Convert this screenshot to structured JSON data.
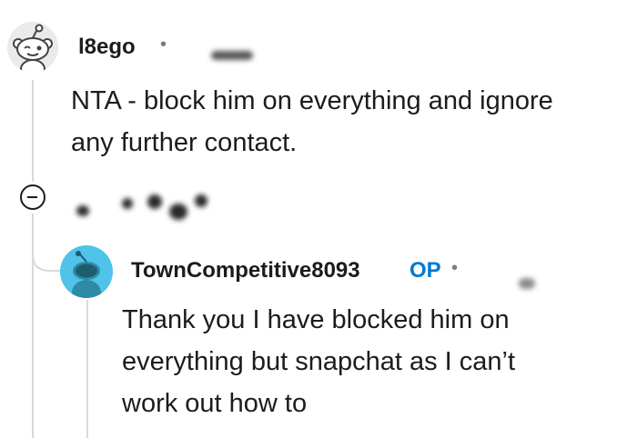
{
  "comments": [
    {
      "author": "l8ego",
      "separator": "•",
      "body_line_1": "NTA - block him on everything and ignore",
      "body_line_2": "any further contact.",
      "avatar_icon": "snoo-avatar-icon"
    },
    {
      "author": "TownCompetitive8093",
      "op_badge": "OP",
      "separator": "•",
      "body_line_1": "Thank you I have blocked him on",
      "body_line_2": "everything but snapchat as I can’t",
      "body_line_3": "work out how to",
      "avatar_icon": "snoo-avatar-icon"
    }
  ],
  "actions": {
    "collapse_icon": "collapse-minus-icon"
  },
  "colors": {
    "op_badge": "#0079d3",
    "reply_avatar_bg": "#4fc3e8",
    "thread_line": "#d6dadc"
  }
}
